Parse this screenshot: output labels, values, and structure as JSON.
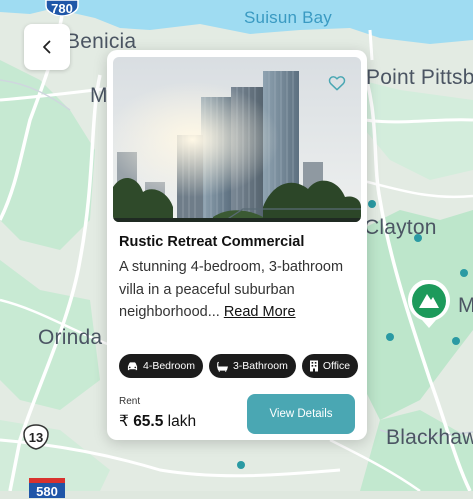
{
  "map": {
    "labels": {
      "suisun_bay": "Suisun Bay",
      "benicia": "Benicia",
      "point_pittsburg": "Point  Pittsb",
      "clayton": "Clayton",
      "orinda": "Orinda",
      "blackhawk": "Blackhaw",
      "m_partial_left": "M",
      "m_partial_right": "M"
    },
    "shields": {
      "i780": "780",
      "r13": "13",
      "i580": "580"
    },
    "park_marker_icon": "mountain-icon"
  },
  "back_button": {
    "icon": "chevron-left-icon"
  },
  "card": {
    "title": "Rustic Retreat Commercial",
    "description": "A stunning 4-bedroom, 3-bathroom villa in a peaceful suburban neighborhood...",
    "read_more": "Read More",
    "tags": [
      {
        "icon": "car-icon",
        "label": "4-Bedroom"
      },
      {
        "icon": "bathtub-icon",
        "label": "3-Bathroom"
      },
      {
        "icon": "building-icon",
        "label": "Office"
      }
    ],
    "rent_label": "Rent",
    "rent_currency": "₹",
    "rent_amount": "65.5",
    "rent_unit": "lakh",
    "cta": "View Details",
    "favorite_icon": "heart-outline-icon"
  },
  "colors": {
    "accent": "#4aa7b3",
    "map_park": "#bfe5cd",
    "map_water": "#8fd4ee",
    "map_road": "#ffffff",
    "marker": "#1d9a5b"
  }
}
